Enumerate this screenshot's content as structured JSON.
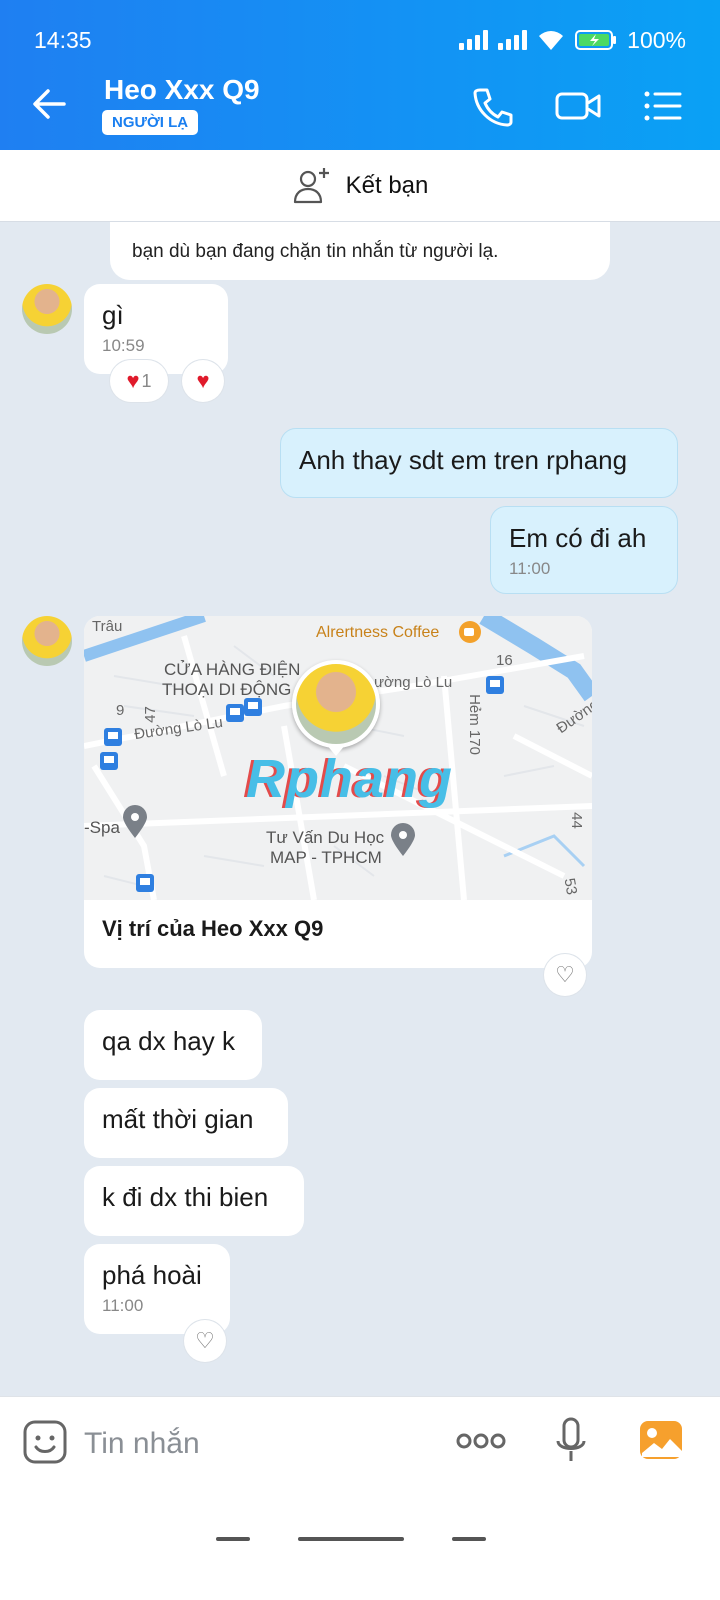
{
  "status_bar": {
    "time": "14:35",
    "battery": "100%"
  },
  "header": {
    "title": "Heo Xxx Q9",
    "badge": "NGƯỜI LẠ"
  },
  "friend_bar": {
    "label": "Kết bạn"
  },
  "system_note": {
    "text": "bạn dù bạn đang chặn tin nhắn từ người lạ."
  },
  "messages": {
    "m1": {
      "text": "gì",
      "time": "10:59",
      "reaction_count": "1"
    },
    "m2": {
      "text": "Anh thay sdt em tren rphang"
    },
    "m3": {
      "text": "Em có đi ah",
      "time": "11:00"
    },
    "location": {
      "caption": "Vị trí của Heo Xxx Q9",
      "map_labels": {
        "coffee": "Alrertness Coffee",
        "store1": "CỬA HÀNG ĐIỆN",
        "store2": "THOẠI DI ĐỘNG",
        "street1": "Đường Lò Lu",
        "street2": "ường Lò Lu",
        "hem": "Hẻm 170",
        "duhoc1": "Tư Vấn Du Học",
        "duhoc2": "MAP - TPHCM",
        "spa": "-Spa",
        "n16": "16",
        "n47": "47",
        "n9": "9",
        "n44": "44",
        "n53": "53",
        "trau": "Trâu",
        "duong": "Đường",
        "watermark": "Rphang"
      }
    },
    "m4": {
      "text": "qa dx hay k"
    },
    "m5": {
      "text": "mất thời gian"
    },
    "m6": {
      "text": "k đi dx thi bien"
    },
    "m7": {
      "text": "phá hoài",
      "time": "11:00"
    }
  },
  "input": {
    "placeholder": "Tin nhắn"
  }
}
